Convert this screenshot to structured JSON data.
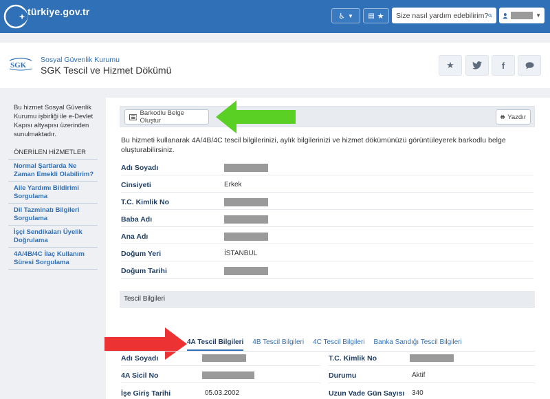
{
  "topbar": {
    "logo_text": "türkiye.gov.tr",
    "search_placeholder": "Size nasıl yardım edebilirim?",
    "colors": {
      "primary": "#2f70b6"
    }
  },
  "header": {
    "org_name": "Sosyal Güvenlik Kurumu",
    "service_name": "SGK Tescil ve Hizmet Dökümü",
    "share_icons": [
      "star-icon",
      "twitter-icon",
      "facebook-icon",
      "comment-icon"
    ]
  },
  "sidebar": {
    "intro": "Bu hizmet Sosyal Güvenlik Kurumu işbirliği ile e-Devlet Kapısı altyapısı üzerinden sunulmaktadır.",
    "title": "ÖNERİLEN HİZMETLER",
    "items": [
      {
        "label": "Normal Şartlarda Ne Zaman Emekli Olabilirim?"
      },
      {
        "label": "Aile Yardımı Bildirimi Sorgulama"
      },
      {
        "label": "Dil Tazminatı Bilgileri Sorgulama"
      },
      {
        "label": "İşçi Sendikaları Üyelik Doğrulama"
      },
      {
        "label": "4A/4B/4C İlaç Kullanım Süresi Sorgulama"
      }
    ]
  },
  "actions": {
    "barcode_label": "Barkodlu Belge Oluştur",
    "print_label": "Yazdır"
  },
  "intro_text": "Bu hizmeti kullanarak 4A/4B/4C tescil bilgilerinizi, aylık bilgilerinizi ve hizmet dökümünüzü görüntüleyerek barkodlu belge oluşturabilirsiniz.",
  "personal": [
    {
      "label": "Adı Soyadı",
      "value": null
    },
    {
      "label": "Cinsiyeti",
      "value": "Erkek"
    },
    {
      "label": "T.C. Kimlik No",
      "value": null
    },
    {
      "label": "Baba Adı",
      "value": null
    },
    {
      "label": "Ana Adı",
      "value": null
    },
    {
      "label": "Doğum Yeri",
      "value": "İSTANBUL"
    },
    {
      "label": "Doğum Tarihi",
      "value": null
    }
  ],
  "section_title": "Tescil Bilgileri",
  "tabs": [
    {
      "label": "4A Tescil Bilgileri",
      "active": true
    },
    {
      "label": "4B Tescil Bilgileri"
    },
    {
      "label": "4C Tescil Bilgileri"
    },
    {
      "label": "Banka Sandığı Tescil Bilgileri"
    }
  ],
  "tescil": {
    "left": [
      {
        "label": "Adı Soyadı",
        "value": null
      },
      {
        "label": "4A Sicil No",
        "value": null
      },
      {
        "label": "İşe Giriş Tarihi",
        "value": "05.03.2002"
      }
    ],
    "right": [
      {
        "label": "T.C. Kimlik No",
        "value": null
      },
      {
        "label": "Durumu",
        "value": "Aktif"
      },
      {
        "label": "Uzun Vade Gün Sayısı",
        "value": "340"
      }
    ]
  }
}
